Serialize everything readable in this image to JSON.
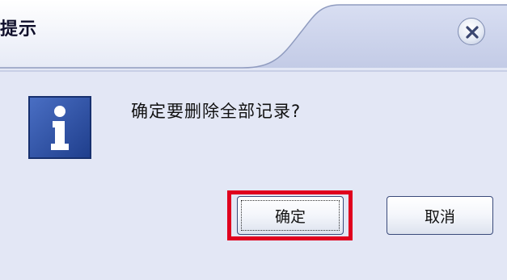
{
  "dialog": {
    "title": "提示",
    "message": "确定要删除全部记录?",
    "icon": "info-icon",
    "close_icon": "close-icon",
    "buttons": {
      "ok_label": "确定",
      "cancel_label": "取消"
    },
    "colors": {
      "background": "#e3e7f5",
      "info_icon_blue": "#2c4fa3",
      "highlight_red": "#e0001e"
    }
  }
}
